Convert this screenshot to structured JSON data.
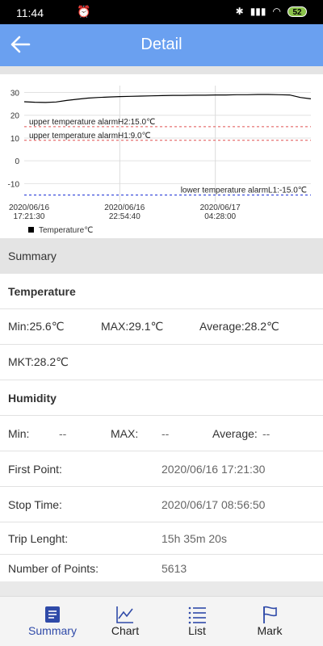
{
  "status_bar": {
    "time": "11:44",
    "battery": "52"
  },
  "header": {
    "title": "Detail"
  },
  "chart_data": {
    "type": "line",
    "y_ticks": [
      "30",
      "20",
      "10",
      "0",
      "-10"
    ],
    "ylim": [
      -18,
      33
    ],
    "x_tick_labels": [
      {
        "date": "2020/06/16",
        "time": "17:21:30"
      },
      {
        "date": "2020/06/16",
        "time": "22:54:40"
      },
      {
        "date": "2020/06/17",
        "time": "04:28:00"
      }
    ],
    "series": [
      {
        "name": "Temperature℃",
        "color": "#000000",
        "values": [
          25.9,
          25.7,
          25.6,
          25.8,
          26.5,
          27.0,
          27.5,
          27.8,
          28.0,
          28.2,
          28.3,
          28.4,
          28.5,
          28.6,
          28.7,
          28.7,
          28.8,
          28.8,
          28.9,
          28.9,
          29.0,
          29.0,
          29.1,
          29.1,
          29.0,
          28.9,
          27.8,
          27.2
        ]
      }
    ],
    "alarm_lines": [
      {
        "label": "upper temperature alarmH2:15.0℃",
        "value": 15.0,
        "color": "#e05050"
      },
      {
        "label": "upper temperature alarmH1:9.0℃",
        "value": 9.0,
        "color": "#e05050"
      },
      {
        "label": "lower temperature alarmL1:-15.0℃",
        "value": -15.0,
        "color": "#1a2fd6"
      }
    ],
    "grid": true,
    "legend_position": "bottom-left"
  },
  "summary_header": "Summary",
  "temperature": {
    "heading": "Temperature",
    "min": "Min:25.6℃",
    "max": "MAX:29.1℃",
    "average": "Average:28.2℃",
    "mkt": "MKT:28.2℃"
  },
  "humidity": {
    "heading": "Humidity",
    "min_label": "Min:",
    "min_value": "--",
    "max_label": "MAX:",
    "max_value": "--",
    "average_label": "Average:",
    "average_value": "--"
  },
  "info": {
    "first_point_label": "First Point:",
    "first_point_value": "2020/06/16 17:21:30",
    "stop_time_label": "Stop Time:",
    "stop_time_value": "2020/06/17 08:56:50",
    "trip_length_label": "Trip Lenght:",
    "trip_length_value": "15h 35m 20s",
    "points_label": "Number of Points:",
    "points_value": "5613"
  },
  "bottom_nav": {
    "summary": "Summary",
    "chart": "Chart",
    "list": "List",
    "mark": "Mark",
    "active_color": "#2f4aa8"
  }
}
